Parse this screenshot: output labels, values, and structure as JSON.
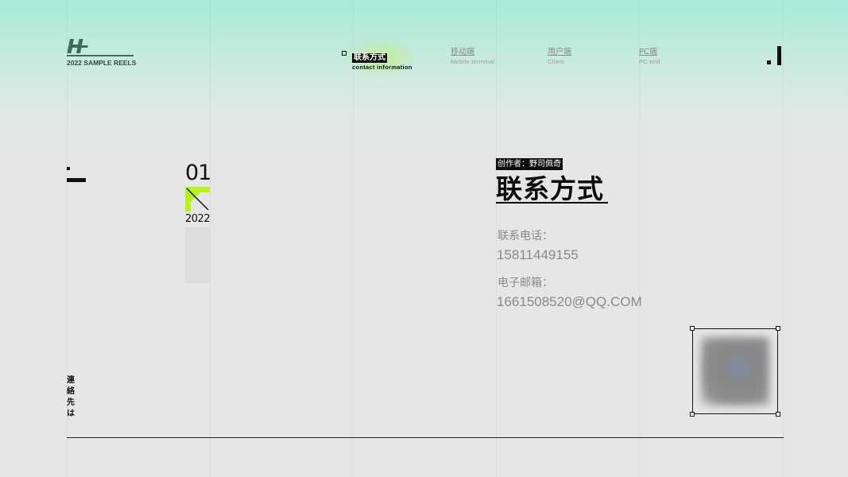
{
  "brand": {
    "logo_icon": "brand-logo-h-icon",
    "caption": "2022 SAMPLE REELS",
    "color": "#2e4b42"
  },
  "nav": {
    "items": [
      {
        "label": "联系方式",
        "sub": "contact  information",
        "active": true
      },
      {
        "label": "移动端",
        "sub": "Mobile  terminal",
        "active": false
      },
      {
        "label": "用户端",
        "sub": "Client",
        "active": false
      },
      {
        "label": "PC端",
        "sub": "PC  end",
        "active": false
      }
    ],
    "accent": "#c6f04f"
  },
  "section": {
    "index": "01",
    "year": "2022",
    "accent": "#b8f21c"
  },
  "side_text": "連絡先は",
  "contact": {
    "creator": "创作者：野司佩奇",
    "title": "联系方式",
    "phone_label": "联系电话：",
    "phone": "15811449155",
    "email_label": "电子邮箱：",
    "email": "1661508520@QQ.COM"
  },
  "qr": {
    "icon": "qr-code-icon"
  },
  "colors": {
    "top_gradient": "#a6ecd8",
    "background": "#e6e6e6",
    "text": "#111111",
    "muted": "#8a8a8a"
  }
}
